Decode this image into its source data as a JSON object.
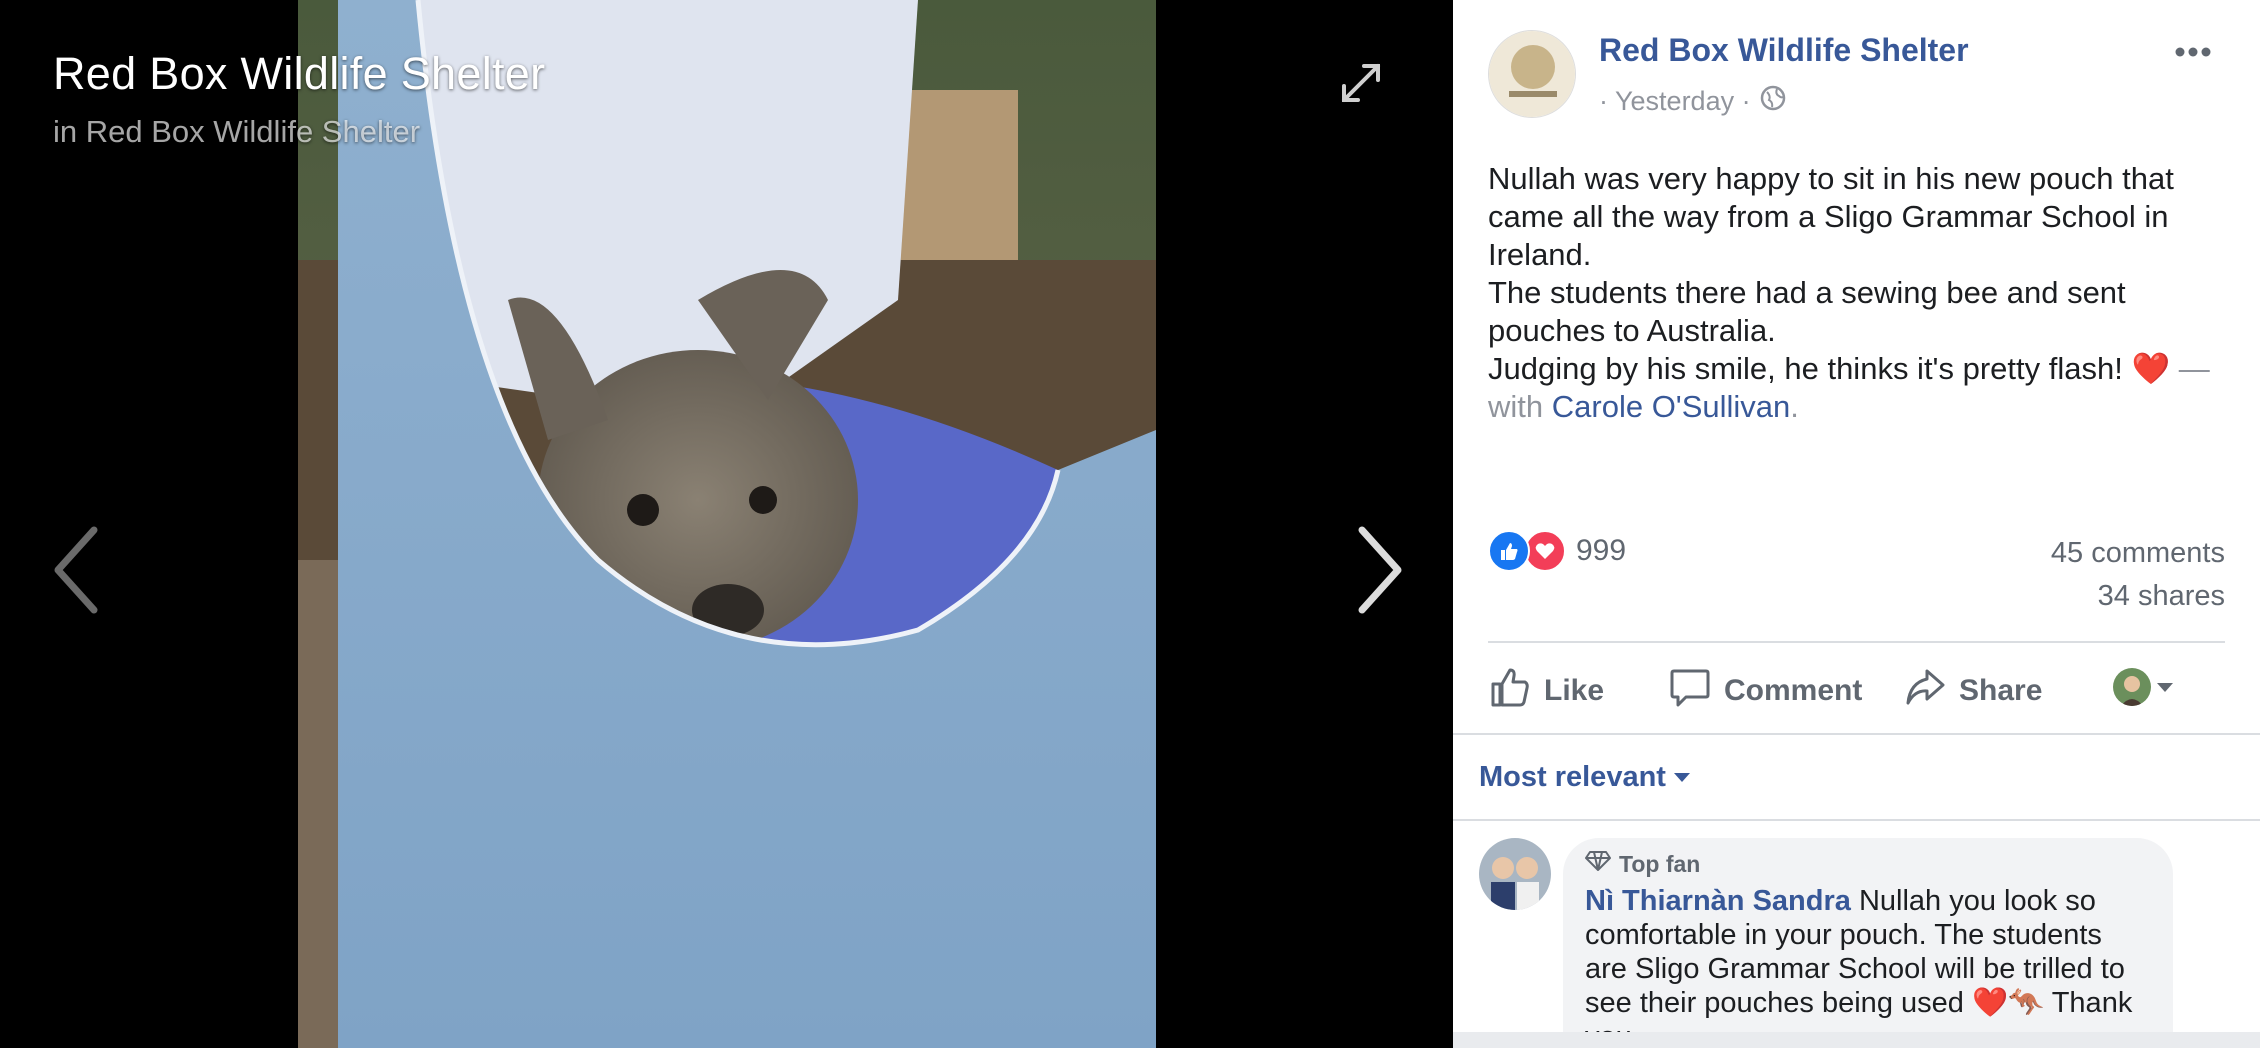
{
  "viewer": {
    "title": "Red Box Wildlife Shelter",
    "in_prefix": "in",
    "in_page": "Red Box Wildlife Shelter"
  },
  "post": {
    "page_name": "Red Box Wildlife Shelter",
    "time": "· Yesterday ·",
    "text_lines": [
      "Nullah was very happy to sit in his new pouch that came all the way from a Sligo Grammar School in Ireland.",
      "The students there had a sewing bee and sent pouches to Australia.",
      "Judging by his smile, he thinks it's pretty flash!"
    ],
    "heart": "❤️",
    "with_dash": "—",
    "with_word": "with",
    "tagged": "Carole O'Sullivan",
    "tagged_period": ".",
    "reactions_count": "999",
    "comments_count": "45 comments",
    "shares_count": "34 shares"
  },
  "actions": {
    "like": "Like",
    "comment": "Comment",
    "share": "Share"
  },
  "sort": {
    "label": "Most relevant"
  },
  "comment": {
    "badge": "Top fan",
    "author": "Nì Thiarnàn Sandra",
    "text": "Nullah you look so comfortable in your pouch. The students are Sligo Grammar School will be trilled to see their pouches being used",
    "emojis": "❤️🦘",
    "tail": "Thank you"
  },
  "colors": {
    "link_blue": "#385898",
    "like_blue": "#1877f2",
    "love_red": "#f33e58",
    "muted_gray": "#90949c"
  },
  "icons": [
    "expand-icon",
    "chevron-left-icon",
    "chevron-right-icon",
    "more-icon",
    "globe-icon",
    "like-reaction-icon",
    "love-reaction-icon",
    "thumbs-up-icon",
    "comment-icon",
    "share-icon",
    "caret-down-icon",
    "diamond-icon"
  ]
}
